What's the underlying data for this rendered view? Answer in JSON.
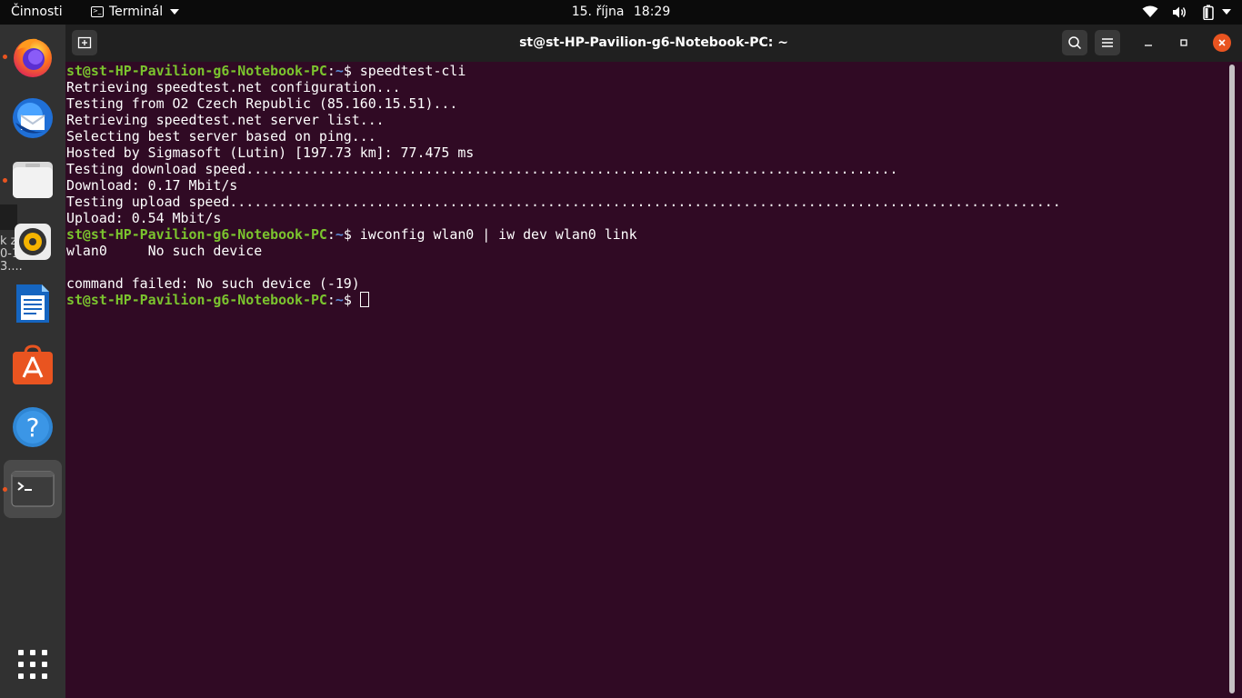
{
  "topbar": {
    "activities": "Činnosti",
    "app_name": "Terminál",
    "date": "15. října",
    "time": "18:29",
    "icons": [
      "wifi-icon",
      "volume-icon",
      "battery-icon",
      "chevron-down-icon"
    ]
  },
  "dock": {
    "items": [
      "firefox",
      "thunderbird",
      "files",
      "rhythmbox",
      "libreoffice-writer",
      "ubuntu-software",
      "help",
      "terminal"
    ],
    "partial_window_text": [
      "k z",
      "0-1",
      "3...."
    ]
  },
  "window": {
    "title": "st@st-HP-Pavilion-g6-Notebook-PC: ~"
  },
  "terminal": {
    "user_host": "st@st-HP-Pavilion-g6-Notebook-PC",
    "path": "~",
    "prompt_symbol": "$",
    "cmd1": "speedtest-cli",
    "out1": [
      "Retrieving speedtest.net configuration...",
      "Testing from O2 Czech Republic (85.160.15.51)...",
      "Retrieving speedtest.net server list...",
      "Selecting best server based on ping...",
      "Hosted by Sigmasoft (Lutin) [197.73 km]: 77.475 ms",
      "Testing download speed................................................................................",
      "Download: 0.17 Mbit/s",
      "Testing upload speed......................................................................................................",
      "Upload: 0.54 Mbit/s"
    ],
    "cmd2": "iwconfig wlan0 | iw dev wlan0 link",
    "out2": [
      "wlan0     No such device",
      "",
      "command failed: No such device (-19)"
    ]
  }
}
